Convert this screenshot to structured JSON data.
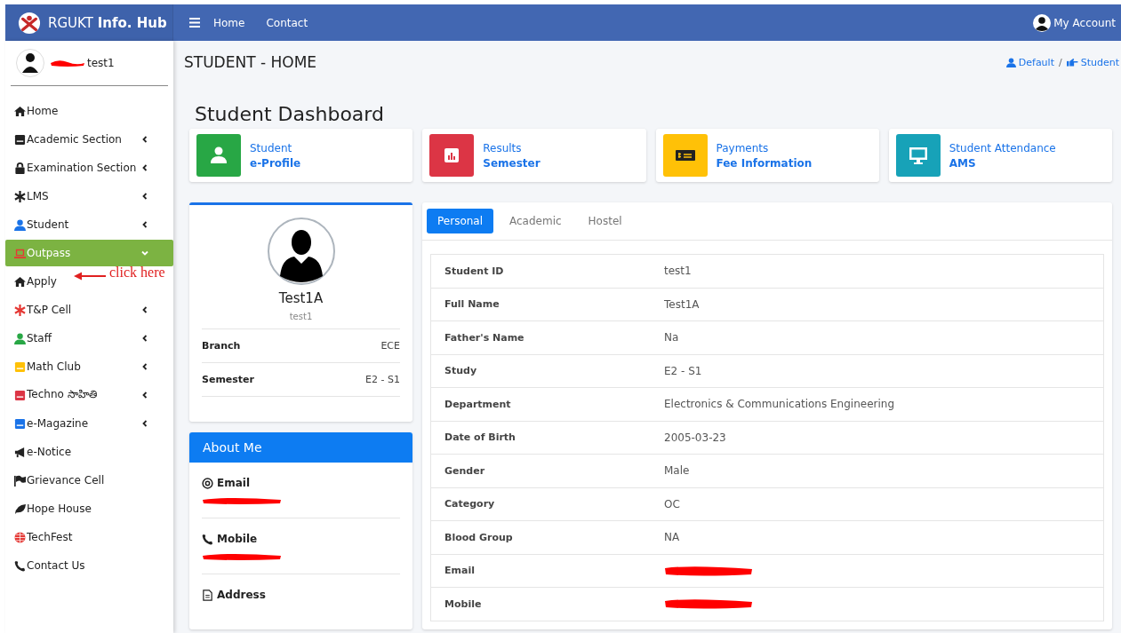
{
  "brand": {
    "title": "RGUKT **Info. Hub**"
  },
  "topbar": {
    "links": [
      "Home",
      "Contact"
    ],
    "account": "My Account"
  },
  "sidebar": {
    "user": {
      "name": "test1",
      "name_redacted": true
    },
    "items": [
      {
        "label": "Home",
        "has_submenu": false,
        "expanded": false
      },
      {
        "label": "Academic Section",
        "has_submenu": true,
        "expanded": false
      },
      {
        "label": "Examination Section",
        "has_submenu": true,
        "expanded": false
      },
      {
        "label": "LMS",
        "has_submenu": true,
        "expanded": false
      },
      {
        "label": "Student",
        "has_submenu": true,
        "expanded": false
      },
      {
        "label": "Outpass",
        "has_submenu": true,
        "expanded": true
      },
      {
        "label": "Apply",
        "has_submenu": false,
        "expanded": false
      },
      {
        "label": "T&P Cell",
        "has_submenu": true,
        "expanded": false
      },
      {
        "label": "Staff",
        "has_submenu": true,
        "expanded": false
      },
      {
        "label": "Math Club",
        "has_submenu": true,
        "expanded": false
      },
      {
        "label": "Techno సాహితి",
        "has_submenu": true,
        "expanded": false
      },
      {
        "label": "e-Magazine",
        "has_submenu": true,
        "expanded": false
      },
      {
        "label": "e-Notice",
        "has_submenu": false,
        "expanded": false
      },
      {
        "label": "Grievance Cell",
        "has_submenu": false,
        "expanded": false
      },
      {
        "label": "Hope House",
        "has_submenu": false,
        "expanded": false
      },
      {
        "label": "TechFest",
        "has_submenu": false,
        "expanded": false
      },
      {
        "label": "Contact Us",
        "has_submenu": false,
        "expanded": false
      }
    ]
  },
  "annotation": {
    "text": "click here"
  },
  "page": {
    "title": "STUDENT - HOME",
    "breadcrumb": [
      "Default",
      "Student"
    ],
    "separator": "/"
  },
  "dashboard": {
    "title": "Student Dashboard",
    "cards": [
      {
        "title": "Student",
        "subtitle": "e-Profile",
        "color": "#28a745"
      },
      {
        "title": "Results",
        "subtitle": "Semester",
        "color": "#dc3545"
      },
      {
        "title": "Payments",
        "subtitle": "Fee Information",
        "color": "#ffc107"
      },
      {
        "title": "Student Attendance",
        "subtitle": "AMS",
        "color": "#17a2b8"
      }
    ]
  },
  "profile": {
    "name": "Test1A",
    "username": "test1",
    "fields": [
      {
        "label": "Branch",
        "value": "ECE"
      },
      {
        "label": "Semester",
        "value": "E2 - S1"
      }
    ]
  },
  "about": {
    "title": "About Me",
    "items": [
      {
        "label": "Email",
        "redacted": true
      },
      {
        "label": "Mobile",
        "redacted": true
      },
      {
        "label": "Address",
        "redacted": false
      }
    ]
  },
  "tabs": [
    {
      "label": "Personal",
      "selected": true
    },
    {
      "label": "Academic",
      "selected": false
    },
    {
      "label": "Hostel",
      "selected": false
    }
  ],
  "details": [
    {
      "label": "Student ID",
      "value": "test1"
    },
    {
      "label": "Full Name",
      "value": "Test1A"
    },
    {
      "label": "Father's Name",
      "value": "Na"
    },
    {
      "label": "Study",
      "value": "E2 - S1"
    },
    {
      "label": "Department",
      "value": "Electronics & Communications Engineering"
    },
    {
      "label": "Date of Birth",
      "value": "2005-03-23"
    },
    {
      "label": "Gender",
      "value": "Male"
    },
    {
      "label": "Category",
      "value": "OC"
    },
    {
      "label": "Blood Group",
      "value": "NA"
    },
    {
      "label": "Email",
      "redacted": true
    },
    {
      "label": "Mobile",
      "redacted": true
    }
  ]
}
